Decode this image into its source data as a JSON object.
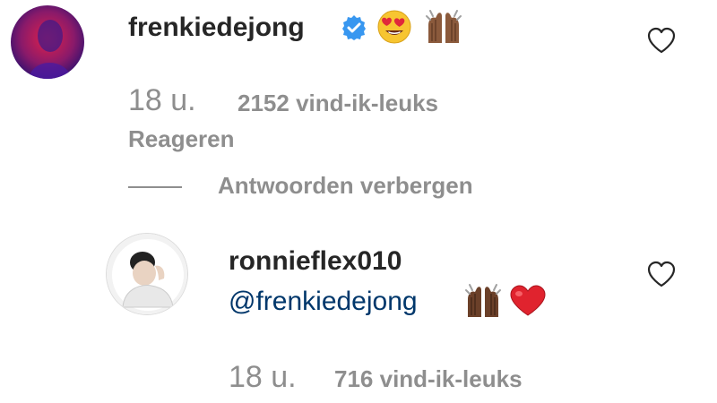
{
  "comments": [
    {
      "username": "frenkiedejong",
      "verified": true,
      "text_emojis": [
        "heart-eyes-emoji",
        "raising-hands-emoji"
      ],
      "time": "18 u.",
      "likes": "2152 vind-ik-leuks",
      "reply_label": "Reageren",
      "like_icon": "heart-outline-icon"
    }
  ],
  "replies_toggle": {
    "label": "Antwoorden verbergen"
  },
  "reply": {
    "username": "ronnieflex010",
    "mention": "@frenkiedejong",
    "text_emojis": [
      "raising-hands-emoji",
      "red-heart-emoji"
    ],
    "time": "18 u.",
    "likes": "716 vind-ik-leuks",
    "like_icon": "heart-outline-icon"
  },
  "colors": {
    "text_primary": "#262626",
    "text_secondary": "#8e8e8e",
    "mention": "#00376b",
    "verified_badge": "#3897f0",
    "heart": "#ed4956"
  }
}
